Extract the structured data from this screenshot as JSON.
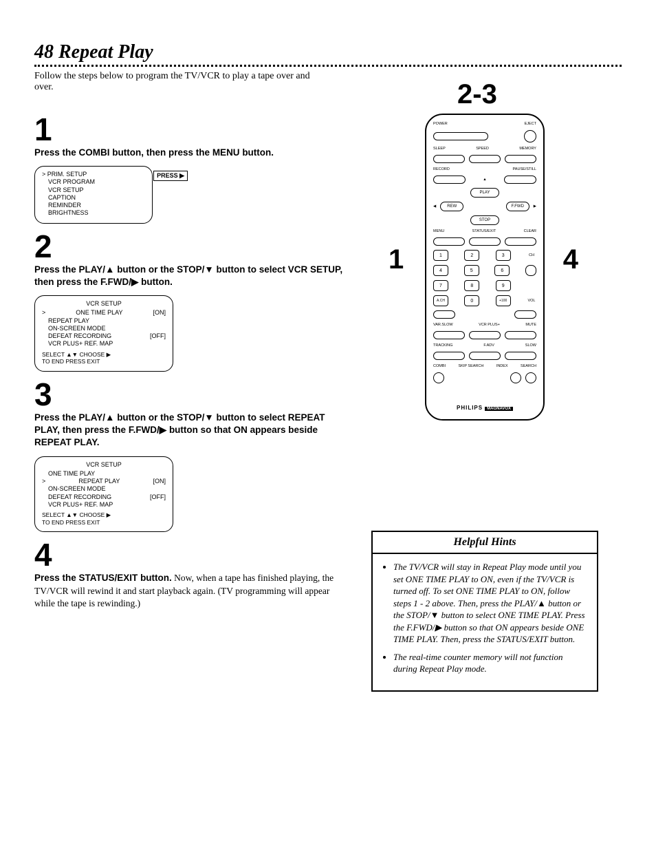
{
  "page": {
    "number": "48",
    "title": "Repeat Play",
    "intro": "Follow the steps below to program the TV/VCR to play a tape over and over."
  },
  "steps": {
    "s1": {
      "num": "1",
      "text_a": "Press the ",
      "bold_a": "COMBI",
      "text_b": " button, then press the ",
      "bold_b": "MENU",
      "text_c": " button."
    },
    "s2": {
      "num": "2",
      "text_a": "Press the ",
      "bold_a": "PLAY/▲",
      "text_b": " button or the ",
      "bold_b": "STOP/▼",
      "text_c": " button to select ",
      "bold_c": "VCR SETUP,",
      "text_d": " then press the ",
      "bold_d": "F.FWD/▶",
      "text_e": " button."
    },
    "s3": {
      "num": "3",
      "text_a": "Press the ",
      "bold_a": "PLAY/▲",
      "text_b": " button or the ",
      "bold_b": "STOP/▼",
      "text_c": " button to select ",
      "bold_c": "REPEAT PLAY,",
      "text_d": " then press the ",
      "bold_d": "F.FWD/▶",
      "text_e": " button so that ",
      "bold_e": "ON",
      "text_f": " appears beside ",
      "bold_f": "REPEAT PLAY."
    },
    "s4": {
      "num": "4",
      "text_a": "Press the ",
      "bold_a": "STATUS/EXIT",
      "text_b": " button.",
      "text_c": " Now, when a tape has finished playing, the TV/VCR will rewind it and start playback again. (TV programming will appear while the tape is rewinding.)"
    }
  },
  "screen1": {
    "press_label": "PRESS ▶",
    "items": [
      "PRIM. SETUP",
      "VCR PROGRAM",
      "VCR SETUP",
      "CAPTION",
      "REMINDER",
      "BRIGHTNESS"
    ]
  },
  "screen2": {
    "title": "VCR SETUP",
    "rows": [
      {
        "label": "ONE TIME PLAY",
        "val": "[ON]",
        "sel": true
      },
      {
        "label": "REPEAT PLAY",
        "val": "",
        "sel": false
      },
      {
        "label": "ON-SCREEN MODE",
        "val": "",
        "sel": false
      },
      {
        "label": "DEFEAT RECORDING",
        "val": "[OFF]",
        "sel": false
      },
      {
        "label": "VCR PLUS+ REF. MAP",
        "val": "",
        "sel": false
      }
    ],
    "footer1": "SELECT ▲▼ CHOOSE ▶",
    "footer2": "TO END PRESS EXIT"
  },
  "screen3": {
    "title": "VCR SETUP",
    "rows": [
      {
        "label": "ONE TIME PLAY",
        "val": "",
        "sel": false
      },
      {
        "label": "REPEAT PLAY",
        "val": "[ON]",
        "sel": true
      },
      {
        "label": "ON-SCREEN MODE",
        "val": "",
        "sel": false
      },
      {
        "label": "DEFEAT RECORDING",
        "val": "[OFF]",
        "sel": false
      },
      {
        "label": "VCR PLUS+ REF. MAP",
        "val": "",
        "sel": false
      }
    ],
    "footer1": "SELECT ▲▼ CHOOSE ▶",
    "footer2": "TO END PRESS EXIT"
  },
  "callouts": {
    "c1": "1",
    "c23": "2-3",
    "c4": "4"
  },
  "remote": {
    "labels": {
      "power": "POWER",
      "eject": "EJECT",
      "sleep": "SLEEP",
      "speed": "SPEED",
      "memory": "MEMORY",
      "record": "RECORD",
      "pause": "PAUSE/STILL",
      "play": "PLAY",
      "rew": "REW",
      "ffwd": "F.FWD",
      "stop": "STOP",
      "menu": "MENU",
      "status": "STATUS/EXIT",
      "clear": "CLEAR",
      "ach": "A.CH",
      "zero": "0",
      "p100": "+100",
      "ch": "CH",
      "vol": "VOL",
      "varslow": "VAR.SLOW",
      "vcrplus": "VCR PLUS+",
      "mute": "MUTE",
      "tracking": "TRACKING",
      "fadv": "F.ADV",
      "slow": "SLOW",
      "combi": "COMBI",
      "skip": "SKIP SEARCH",
      "index": "INDEX",
      "search": "SEARCH"
    },
    "brand": "PHILIPS",
    "brand2": "MAGNAVOX"
  },
  "hints": {
    "title": "Helpful Hints",
    "items": [
      "The TV/VCR will stay in Repeat Play mode until you set ONE TIME PLAY to ON, even if the TV/VCR is turned off. To set ONE TIME PLAY to ON, follow steps 1 - 2 above. Then, press the PLAY/▲ button or the STOP/▼ button to select ONE TIME PLAY. Press the F.FWD/▶ button so that ON appears beside ONE TIME PLAY. Then, press the STATUS/EXIT button.",
      "The real-time counter memory will not function during Repeat Play mode."
    ]
  }
}
